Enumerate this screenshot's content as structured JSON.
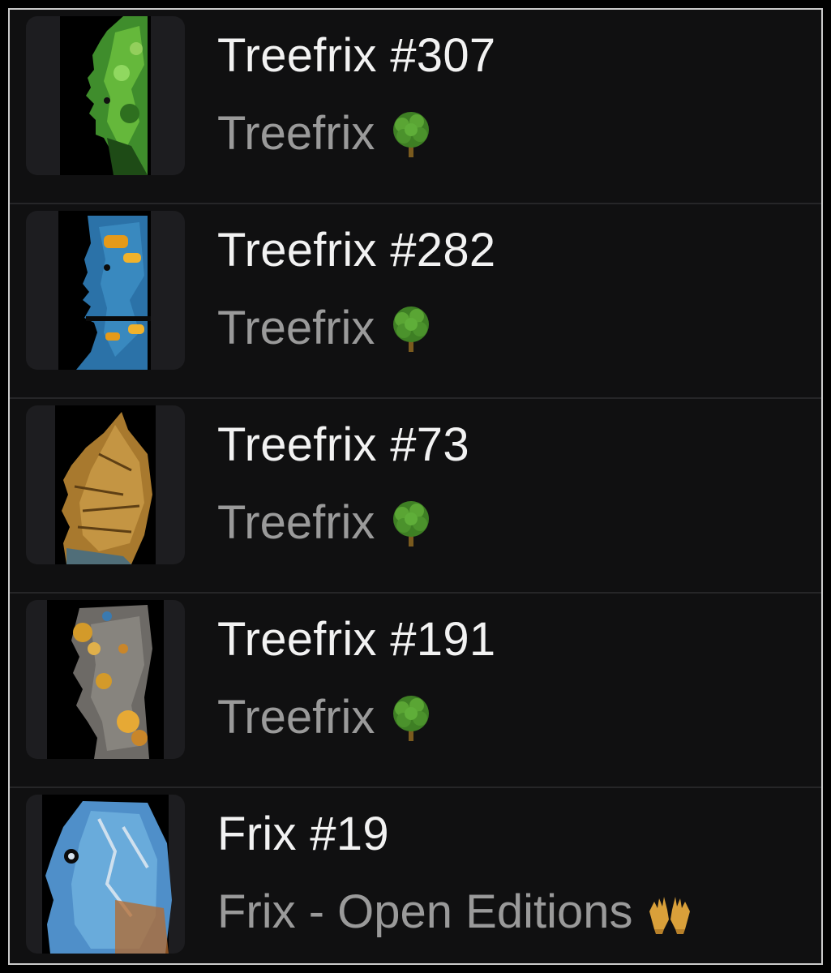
{
  "items": [
    {
      "title": "Treefrix #307",
      "collection": "Treefrix",
      "collection_icon": "deciduous-tree-icon",
      "thumbnail_icon": "green-foliage-face-artwork"
    },
    {
      "title": "Treefrix #282",
      "collection": "Treefrix",
      "collection_icon": "deciduous-tree-icon",
      "thumbnail_icon": "blue-lichen-bark-face-artwork"
    },
    {
      "title": "Treefrix #73",
      "collection": "Treefrix",
      "collection_icon": "deciduous-tree-icon",
      "thumbnail_icon": "golden-bark-face-artwork"
    },
    {
      "title": "Treefrix #191",
      "collection": "Treefrix",
      "collection_icon": "deciduous-tree-icon",
      "thumbnail_icon": "gray-moss-bark-face-artwork"
    },
    {
      "title": "Frix #19",
      "collection": "Frix - Open Editions",
      "collection_icon": "open-hands-icon",
      "thumbnail_icon": "blue-stone-face-artwork"
    }
  ],
  "colors": {
    "background": "#0f0f10",
    "title_text": "#f2f2f2",
    "subtitle_text": "#9a9a9a",
    "divider": "#262628",
    "thumb_background": "#1d1d20"
  }
}
